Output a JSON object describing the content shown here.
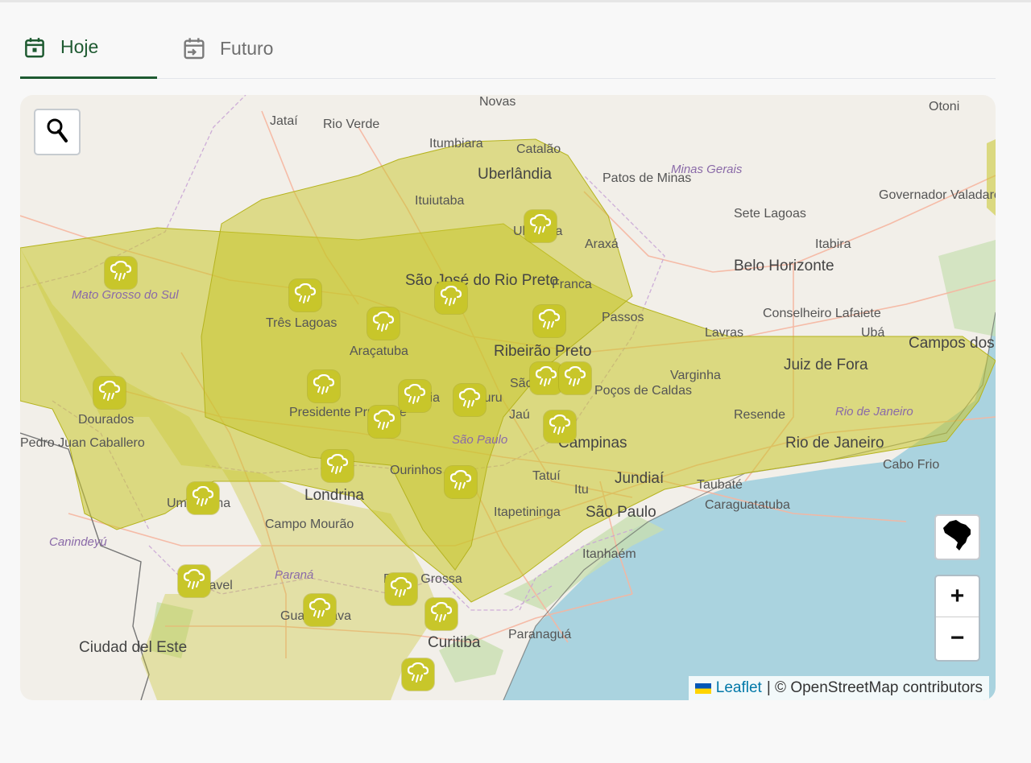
{
  "tabs": {
    "today": {
      "label": "Hoje",
      "icon": "calendar-today-icon"
    },
    "future": {
      "label": "Futuro",
      "icon": "calendar-forward-icon"
    }
  },
  "map": {
    "alert_color": "#c8c62a",
    "cities": [
      "Novas",
      "Otoni",
      "Jataí",
      "Rio Verde",
      "Itumbiara",
      "Catalão",
      "Uberlândia",
      "Patos de Minas",
      "Ituiutaba",
      "Governador Valadares",
      "Sete Lagoas",
      "Itabira",
      "Uberaba",
      "Araxá",
      "Belo Horizonte",
      "São José do Rio Preto",
      "Franca",
      "Três Lagoas",
      "Conselheiro Lafaiete",
      "Passos",
      "Lavras",
      "Ubá",
      "Araçatuba",
      "Ribeirão Preto",
      "Campos dos Goytacazes",
      "Juiz de Fora",
      "Varginha",
      "Dourados",
      "São Carlos",
      "Poços de Caldas",
      "Presidente Prudente",
      "Marília",
      "Bauru",
      "Jaú",
      "Resende",
      "Pedro Juan Caballero",
      "Campinas",
      "Rio de Janeiro",
      "Ourinhos",
      "Taubaté",
      "Cabo Frio",
      "Tatuí",
      "Jundiaí",
      "Umuarama",
      "Itu",
      "Londrina",
      "Itapetininga",
      "São Paulo",
      "Caraguatatuba",
      "Campo Mourão",
      "Itanhaém",
      "Cascavel",
      "Ponta Grossa",
      "Guarapuava",
      "Ciudad del Este",
      "Curitiba",
      "Paranaguá"
    ],
    "regions": [
      "Minas Gerais",
      "Mato Grosso do Sul",
      "São Paulo",
      "Rio de Janeiro",
      "Paraná",
      "Canindeyú"
    ],
    "rain_markers_count": 22,
    "attribution": {
      "leaflet": "Leaflet",
      "osm": "| © OpenStreetMap contributors"
    },
    "controls": {
      "zoom_in": "+",
      "zoom_out": "−"
    }
  }
}
